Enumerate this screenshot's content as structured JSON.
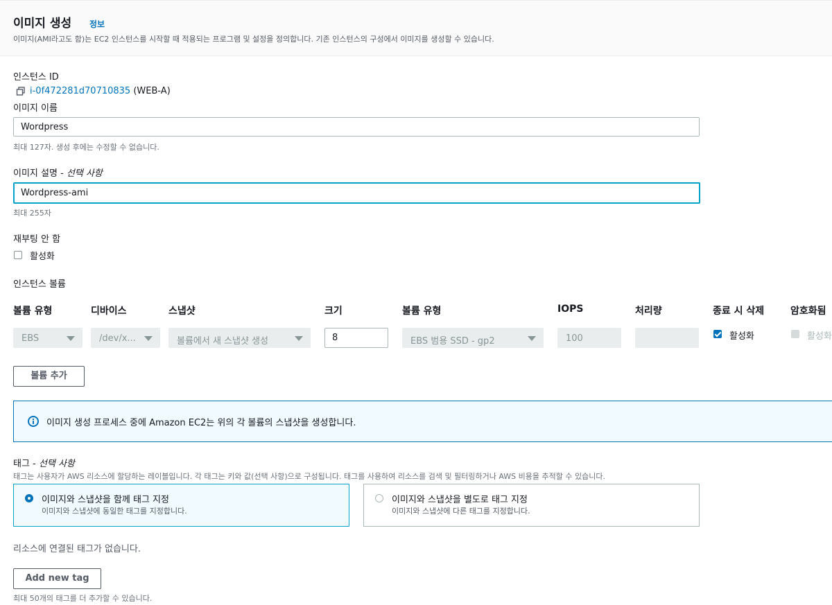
{
  "header": {
    "title": "이미지 생성",
    "info_link": "정보",
    "description": "이미지(AMI라고도 함)는 EC2 인스턴스를 시작할 때 적용되는 프로그램 및 설정을 정의합니다. 기존 인스턴스의 구성에서 이미지를 생성할 수 있습니다."
  },
  "instance": {
    "label": "인스턴스 ID",
    "id": "i-0f472281d70710835",
    "name": "(WEB-A)",
    "copy_icon": "copy-icon"
  },
  "image_name": {
    "label": "이미지 이름",
    "value": "Wordpress",
    "hint": "최대 127자. 생성 후에는 수정할 수 없습니다."
  },
  "image_description": {
    "label": "이미지 설명 - ",
    "label_optional": "선택 사항",
    "value": "Wordpress-ami",
    "hint": "최대 255자"
  },
  "no_reboot": {
    "label": "재부팅 안 함",
    "checkbox_label": "활성화",
    "checked": false
  },
  "volumes": {
    "section_label": "인스턴스 볼륨",
    "columns": [
      "볼륨 유형",
      "디바이스",
      "스냅샷",
      "크기",
      "볼륨 유형",
      "IOPS",
      "처리량",
      "종료 시 삭제",
      "암호화됨"
    ],
    "row": {
      "volume_type": "EBS",
      "device": "/dev/x...",
      "snapshot": "볼륨에서 새 스냅샷 생성",
      "size": "8",
      "ebs_type": "EBS 범용 SSD - gp2",
      "iops": "100",
      "throughput": "",
      "delete_on_termination": "활성화",
      "delete_checked": true,
      "encrypted": "활성화",
      "encrypted_checked": false
    },
    "add_button": "볼륨 추가"
  },
  "alert": {
    "icon": "info-icon",
    "text": "이미지 생성 프로세스 중에 Amazon EC2는 위의 각 볼륨의 스냅샷을 생성합니다."
  },
  "tags": {
    "label": "태그 - ",
    "label_optional": "선택 사항",
    "description": "태그는 사용자가 AWS 리소스에 할당하는 레이블입니다. 각 태그는 키와 값(선택 사항)으로 구성됩니다. 태그를 사용하여 리소스를 검색 및 필터링하거나 AWS 비용을 추적할 수 있습니다.",
    "options": [
      {
        "title": "이미지와 스냅샷을 함께 태그 지정",
        "desc": "이미지와 스냅샷에 동일한 태그를 지정합니다.",
        "selected": true
      },
      {
        "title": "이미지와 스냅샷을 별도로 태그 지정",
        "desc": "이미지와 스냅샷에 다른 태그를 지정합니다.",
        "selected": false
      }
    ],
    "empty_text": "리소스에 연결된 태그가 없습니다.",
    "add_button": "Add new tag",
    "limit_hint": "최대 50개의 태그를 더 추가할 수 있습니다."
  }
}
